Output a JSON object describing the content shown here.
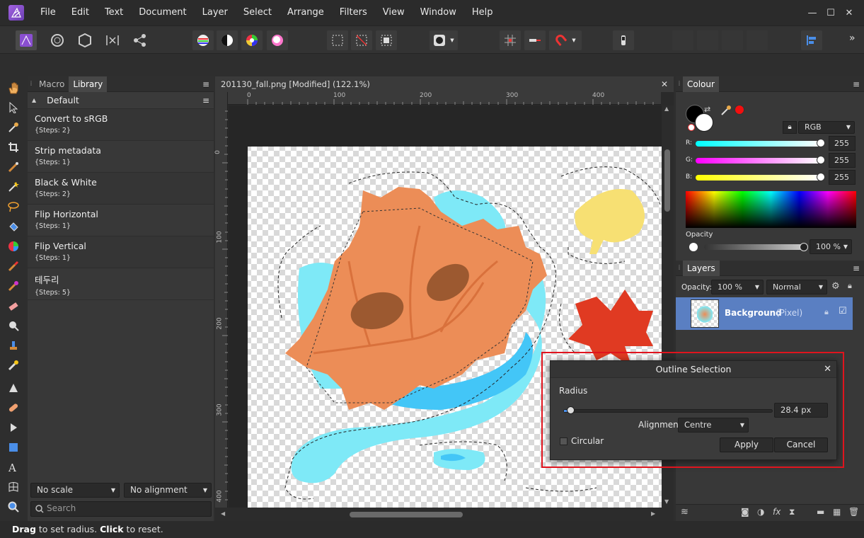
{
  "menu": [
    "File",
    "Edit",
    "Text",
    "Document",
    "Layer",
    "Select",
    "Arrange",
    "Filters",
    "View",
    "Window",
    "Help"
  ],
  "window_controls": {
    "minimize": "—",
    "maximize": "☐",
    "close": "✕"
  },
  "toolbar": {
    "overflow": "»"
  },
  "library_panel": {
    "tabs": [
      "Macro",
      "Library"
    ],
    "active_tab": "Library",
    "group": "Default",
    "items": [
      {
        "name": "Convert to sRGB",
        "steps": "{Steps: 2}"
      },
      {
        "name": "Strip metadata",
        "steps": "{Steps: 1}"
      },
      {
        "name": "Black & White",
        "steps": "{Steps: 2}"
      },
      {
        "name": "Flip Horizontal",
        "steps": "{Steps: 1}"
      },
      {
        "name": "Flip Vertical",
        "steps": "{Steps: 1}"
      },
      {
        "name": "테두리",
        "steps": "{Steps: 5}"
      }
    ],
    "scale_select": "No scale",
    "alignment_select": "No alignment",
    "search_placeholder": "Search"
  },
  "document": {
    "tab_title": "201130_fall.png [Modified] (122.1%)",
    "ruler_unit": "px",
    "ruler_h_labels": [
      "0",
      "100",
      "200",
      "300",
      "400"
    ],
    "ruler_v_labels": [
      "0",
      "100",
      "200",
      "300",
      "400"
    ]
  },
  "colour_panel": {
    "tab": "Colour",
    "model": "RGB",
    "r_label": "R:",
    "r_value": "255",
    "g_label": "G:",
    "g_value": "255",
    "b_label": "B:",
    "b_value": "255",
    "opacity_label": "Opacity",
    "opacity_value": "100 %"
  },
  "layers_panel": {
    "tab": "Layers",
    "opacity_label": "Opacity:",
    "opacity_value": "100 %",
    "blend_mode": "Normal",
    "layer_name": "Background",
    "layer_type": "(Pixel)"
  },
  "dialog": {
    "title": "Outline Selection",
    "radius_label": "Radius",
    "radius_value": "28.4 px",
    "alignment_label": "Alignment:",
    "alignment_value": "Centre",
    "circular_label": "Circular",
    "apply_label": "Apply",
    "cancel_label": "Cancel"
  },
  "status": {
    "drag": "Drag",
    "drag_text": " to set radius. ",
    "click": "Click",
    "click_text": " to reset."
  },
  "colors": {
    "accent": "#5a7fc2",
    "highlight_box": "#e0141e",
    "leaf_orange": "#ec8d57",
    "leaf_red": "#e03a22",
    "leaf_yellow": "#f7e073",
    "water_cyan": "#7ee9f7",
    "water_blue": "#43c6f7"
  }
}
